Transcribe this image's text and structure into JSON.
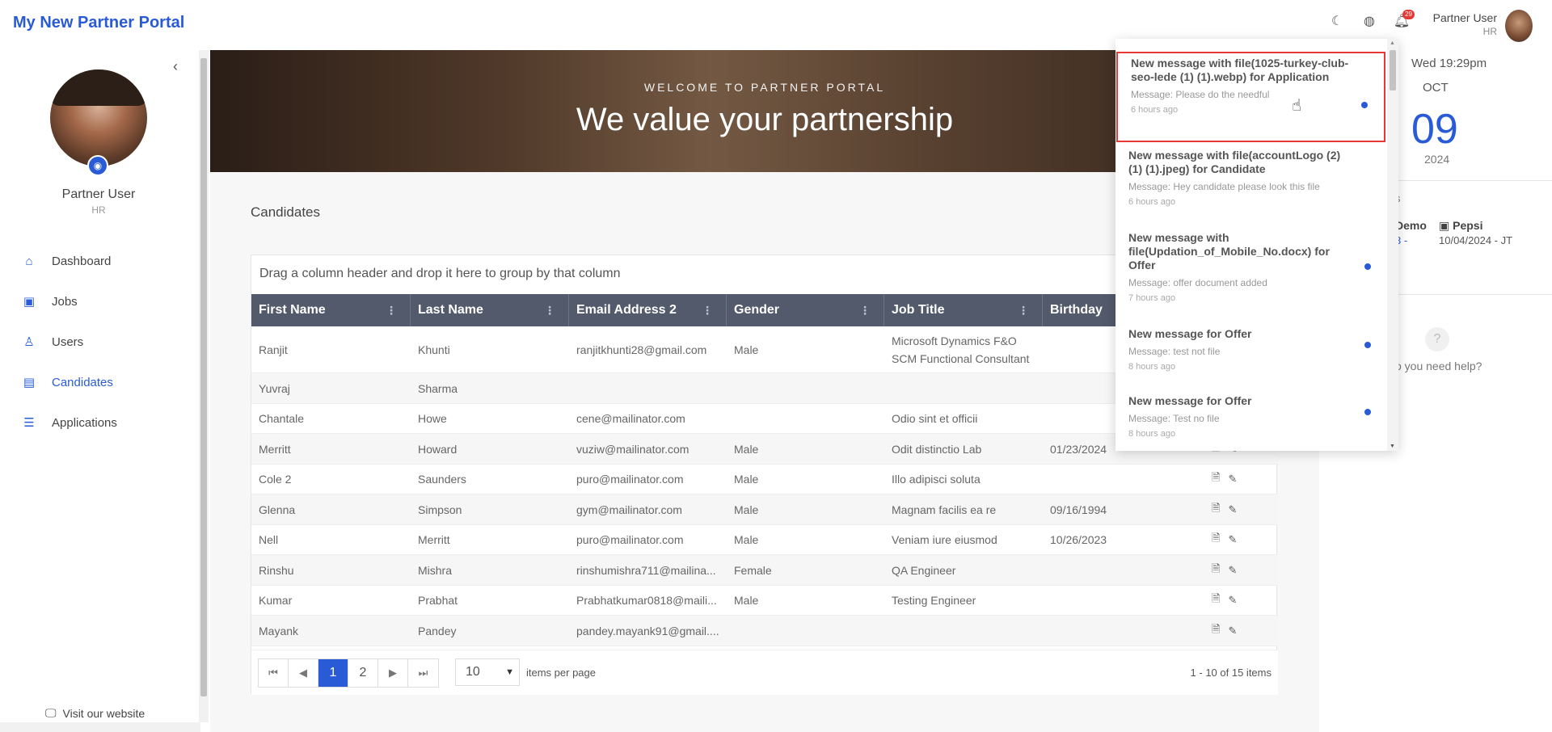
{
  "header": {
    "brand": "My New Partner Portal",
    "user_name": "Partner User",
    "user_role": "HR",
    "notif_count": "29"
  },
  "sidebar": {
    "user_name": "Partner User",
    "user_role": "HR",
    "items": [
      {
        "label": "Dashboard",
        "icon": "home-icon"
      },
      {
        "label": "Jobs",
        "icon": "briefcase-icon"
      },
      {
        "label": "Users",
        "icon": "user-icon"
      },
      {
        "label": "Candidates",
        "icon": "id-card-icon"
      },
      {
        "label": "Applications",
        "icon": "list-icon"
      }
    ],
    "visit_label": "Visit our website"
  },
  "hero": {
    "subtitle": "WELCOME TO PARTNER PORTAL",
    "title": "We value your partnership"
  },
  "candidates": {
    "section_title": "Candidates",
    "group_hint": "Drag a column header and drop it here to group by that column",
    "columns": [
      "First Name",
      "Last Name",
      "Email Address 2",
      "Gender",
      "Job Title",
      "Birthday"
    ],
    "rows": [
      {
        "first": "Ranjit",
        "last": "Khunti",
        "email": "ranjitkhunti28@gmail.com",
        "gender": "Male",
        "job": "Microsoft Dynamics F&O SCM Functional Consultant",
        "birthday": ""
      },
      {
        "first": "Yuvraj",
        "last": "Sharma",
        "email": "",
        "gender": "",
        "job": "",
        "birthday": ""
      },
      {
        "first": "Chantale",
        "last": "Howe",
        "email": "cene@mailinator.com",
        "gender": "",
        "job": "Odio sint et officii",
        "birthday": ""
      },
      {
        "first": "Merritt",
        "last": "Howard",
        "email": "vuziw@mailinator.com",
        "gender": "Male",
        "job": "Odit distinctio Lab",
        "birthday": "01/23/2024"
      },
      {
        "first": "Cole 2",
        "last": "Saunders",
        "email": "puro@mailinator.com",
        "gender": "Male",
        "job": "Illo adipisci soluta",
        "birthday": ""
      },
      {
        "first": "Glenna",
        "last": "Simpson",
        "email": "gym@mailinator.com",
        "gender": "Male",
        "job": "Magnam facilis ea re",
        "birthday": "09/16/1994"
      },
      {
        "first": "Nell",
        "last": "Merritt",
        "email": "puro@mailinator.com",
        "gender": "Male",
        "job": "Veniam iure eiusmod",
        "birthday": "10/26/2023"
      },
      {
        "first": "Rinshu",
        "last": "Mishra",
        "email": "rinshumishra711@mailina...",
        "gender": "Female",
        "job": "QA Engineer",
        "birthday": ""
      },
      {
        "first": "Kumar",
        "last": "Prabhat",
        "email": "Prabhatkumar0818@maili...",
        "gender": "Male",
        "job": "Testing Engineer",
        "birthday": ""
      },
      {
        "first": "Mayank",
        "last": "Pandey",
        "email": "pandey.mayank91@gmail....",
        "gender": "",
        "job": "",
        "birthday": ""
      }
    ],
    "pager": {
      "first": "⏮",
      "prev": "◀",
      "pages": [
        "1",
        "2"
      ],
      "next": "▶",
      "last": "⏭",
      "per_page": "10",
      "per_page_label": "items per page",
      "range": "1 - 10 of 15 items"
    }
  },
  "right_panel": {
    "date_line": "Wed 19:29pm",
    "month": "OCT",
    "day": "09",
    "year": "2024",
    "cut_heading": "s",
    "demo": "Demo",
    "dash": "3 -",
    "pepsi": "Pepsi",
    "pepsi_date": "10/04/2024 - JT",
    "help_text": "o you need help?",
    "help_icon": "?"
  },
  "notifications": [
    {
      "title": "New message with file(1025-turkey-club-seo-lede (1) (1).webp) for Application",
      "message": "Message: Please do the needful",
      "time": "6 hours ago",
      "unread": true
    },
    {
      "title": "New message with file(accountLogo (2) (1) (1).jpeg) for Candidate",
      "message": "Message: Hey candidate please look this file",
      "time": "6 hours ago",
      "unread": false
    },
    {
      "title": "New message with file(Updation_of_Mobile_No.docx) for Offer",
      "message": "Message: offer document added",
      "time": "7 hours ago",
      "unread": true
    },
    {
      "title": "New message for Offer",
      "message": "Message: test not file",
      "time": "8 hours ago",
      "unread": true
    },
    {
      "title": "New message for Offer",
      "message": "Message: Test no file",
      "time": "8 hours ago",
      "unread": true
    }
  ],
  "colors": {
    "accent": "#2a5bd7",
    "header_bg": "#525a6b",
    "highlight": "#e53935"
  }
}
